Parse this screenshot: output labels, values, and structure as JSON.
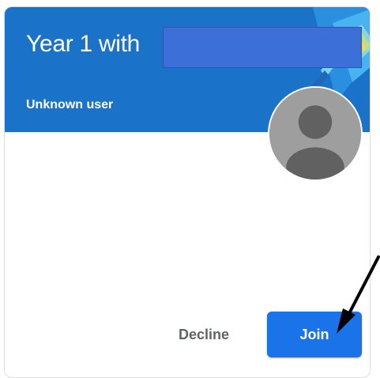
{
  "card": {
    "class_title": "Year 1 with",
    "user_name": "Unknown user",
    "avatar_icon": "person-placeholder-icon",
    "redacted": true
  },
  "actions": {
    "decline_label": "Decline",
    "join_label": "Join"
  },
  "colors": {
    "banner": "#1a73c8",
    "primary_button": "#1a73e8",
    "redaction": "#3c6fd8",
    "secondary_text": "#5f6368"
  }
}
